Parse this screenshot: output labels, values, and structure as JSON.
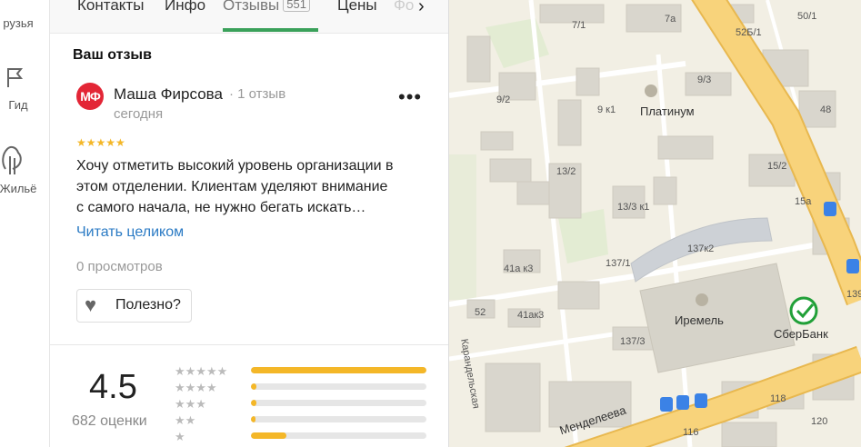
{
  "rail": {
    "items": [
      {
        "label": "рузья",
        "icon": "friends-icon"
      },
      {
        "label": "Гид",
        "icon": "flag-icon"
      },
      {
        "label": "Жильё",
        "icon": "house-icon"
      }
    ]
  },
  "tabs": {
    "items": [
      "Контакты",
      "Инфо",
      "Отзывы",
      "Цены",
      "Фо"
    ],
    "reviews_count": "551",
    "active": "Отзывы"
  },
  "review": {
    "section_title": "Ваш отзыв",
    "avatar_initials": "МФ",
    "author": "Маша Фирсова",
    "reviews_count": "· 1 отзыв",
    "date": "сегодня",
    "stars": "★★★★★",
    "rating": 5,
    "text": "Хочу отметить высокий уровень организации в\nэтом отделении. Клиентам уделяют внимание\nс самого начала, не нужно бегать искать…",
    "read_more": "Читать целиком",
    "views": "0 просмотров",
    "useful_label": "Полезно?"
  },
  "summary": {
    "rating": "4.5",
    "ratings_count": "682 оценки",
    "distribution": [
      {
        "stars": "★★★★★",
        "fraction": 1.0
      },
      {
        "stars": "★★★★",
        "fraction": 0.03
      },
      {
        "stars": "★★★",
        "fraction": 0.03
      },
      {
        "stars": "★★",
        "fraction": 0.02
      },
      {
        "stars": "★",
        "fraction": 0.2
      }
    ]
  },
  "map": {
    "labels": [
      "7/1",
      "7а",
      "50/1",
      "52Б/1",
      "9/3",
      "9/2",
      "9 к1",
      "Платинум",
      "48",
      "13/2",
      "15/2",
      "13/3 к1",
      "15а",
      "137к2",
      "137/1",
      "41а к3",
      "41ак3",
      "52",
      "137/3",
      "Иремель",
      "СберБанк",
      "139",
      "Карандельская",
      "Менделеева",
      "118",
      "116",
      "120"
    ],
    "colors": {
      "road_major": "#f8d37b",
      "road_edge": "#e8b84f",
      "building": "#d9d6cd",
      "land": "#f2efe4",
      "sber_green": "#21a038"
    }
  }
}
